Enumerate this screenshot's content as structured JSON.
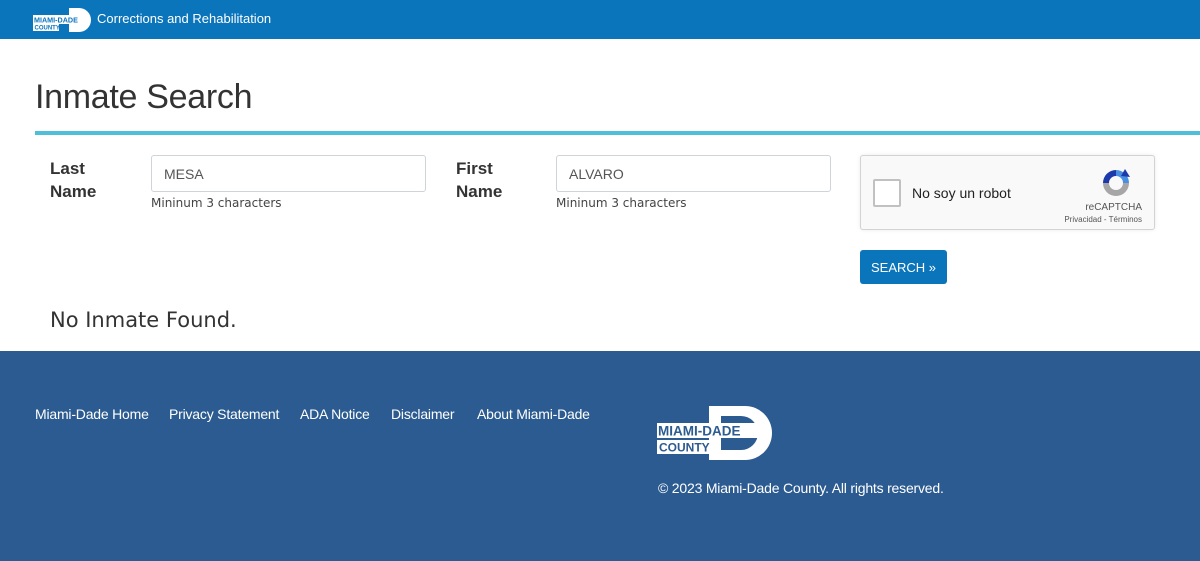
{
  "header": {
    "logo": {
      "line1": "MIAMI-DADE",
      "line2": "COUNTY"
    },
    "site_title": "Corrections and Rehabilitation",
    "color": "#0b75bc"
  },
  "page": {
    "title": "Inmate Search",
    "accent_color": "#4ebed9"
  },
  "form": {
    "last_name": {
      "label_line1": "Last",
      "label_line2": "Name",
      "value": "MESA",
      "help": "Mininum 3 characters"
    },
    "first_name": {
      "label_line1": "First",
      "label_line2": "Name",
      "value": "ALVARO",
      "help": "Mininum 3 characters"
    },
    "captcha": {
      "label": "No soy un robot",
      "brand": "reCAPTCHA",
      "links": "Privacidad - Términos",
      "checked": false,
      "icon": "recaptcha-icon"
    },
    "search_button": "SEARCH »"
  },
  "result": {
    "message": "No Inmate Found."
  },
  "footer": {
    "links": [
      "Miami-Dade Home",
      "Privacy Statement",
      "ADA Notice",
      "Disclaimer",
      "About Miami-Dade"
    ],
    "logo": {
      "line1": "MIAMI-DADE",
      "line2": "COUNTY"
    },
    "copyright": "© 2023 Miami-Dade County. All rights reserved.",
    "color": "#2b5b90"
  }
}
